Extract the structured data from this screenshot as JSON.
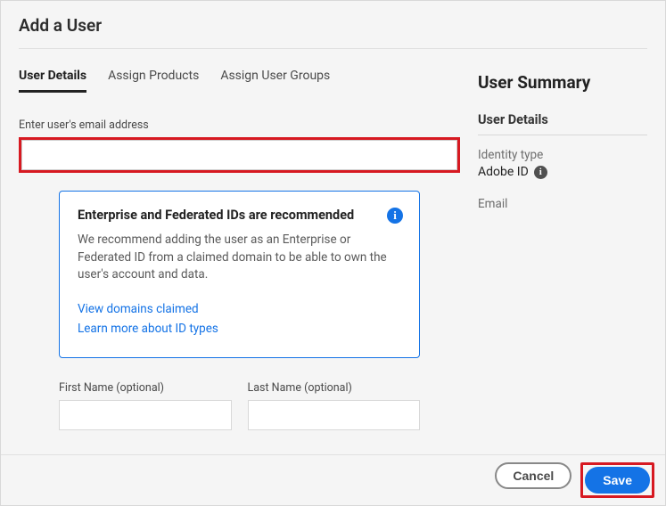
{
  "title": "Add a User",
  "tabs": [
    {
      "label": "User Details"
    },
    {
      "label": "Assign Products"
    },
    {
      "label": "Assign User Groups"
    }
  ],
  "email": {
    "label": "Enter user's email address",
    "value": ""
  },
  "info": {
    "title": "Enterprise and Federated IDs are recommended",
    "text": "We recommend adding the user as an Enterprise or Federated ID from a claimed domain to be able to own the user's account and data.",
    "link1": "View domains claimed",
    "link2": "Learn more about ID types"
  },
  "first_name": {
    "label": "First Name (optional)",
    "value": ""
  },
  "last_name": {
    "label": "Last Name (optional)",
    "value": ""
  },
  "summary": {
    "title": "User Summary",
    "section": "User Details",
    "identity_label": "Identity type",
    "identity_value": "Adobe ID",
    "email_label": "Email"
  },
  "footer": {
    "cancel": "Cancel",
    "save": "Save"
  }
}
